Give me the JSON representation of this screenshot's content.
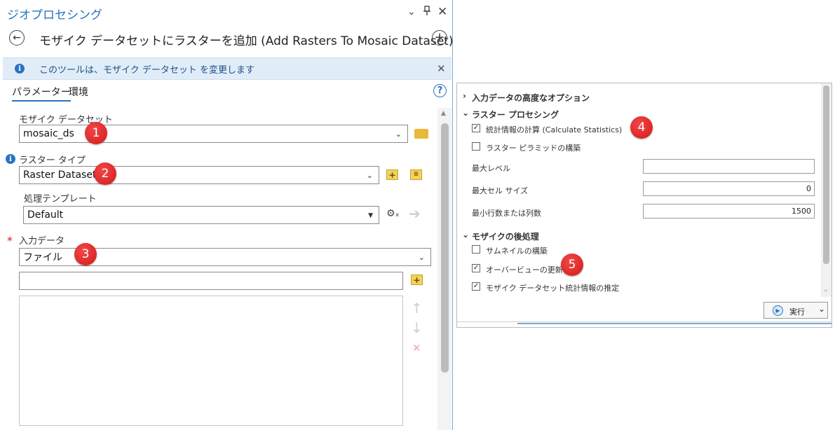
{
  "pane": {
    "title": "ジオプロセシング",
    "icons": {
      "menu": "chevron-down-icon",
      "pin": "pin-icon",
      "close": "close-icon"
    }
  },
  "tool": {
    "title": "モザイク データセットにラスターを追加 (Add Rasters To Mosaic Dataset)",
    "back_icon": "back-arrow-icon",
    "add_icon": "plus-circle-icon"
  },
  "info_banner": {
    "text": "このツールは、モザイク データセット を変更します"
  },
  "tabs": [
    {
      "label": "パラメーター"
    },
    {
      "label": "環境"
    }
  ],
  "params": {
    "mosaic_dataset": {
      "label": "モザイク データセット",
      "value": "mosaic_ds"
    },
    "raster_type": {
      "label": "ラスター タイプ",
      "value": "Raster Dataset"
    },
    "processing_template": {
      "label": "処理テンプレート",
      "value": "Default"
    },
    "input_data": {
      "label": "入力データ",
      "required_mark": "*",
      "value": "ファイル"
    }
  },
  "markers": [
    "1",
    "2",
    "3",
    "4",
    "5"
  ],
  "right_panel": {
    "sections": {
      "advanced_input": "入力データの高度なオプション",
      "raster_processing": "ラスター プロセシング",
      "mosaic_post": "モザイクの後処理"
    },
    "checkboxes": {
      "calculate_statistics": {
        "label": "統計情報の計算 (Calculate Statistics)",
        "checked": true,
        "mark": "✓"
      },
      "build_pyramids": {
        "label": "ラスター ピラミッドの構築",
        "checked": false,
        "mark": ""
      },
      "build_thumbnails": {
        "label": "サムネイルの構築",
        "checked": false,
        "mark": ""
      },
      "update_overviews": {
        "label": "オーバービューの更新",
        "checked": true,
        "mark": "✓"
      },
      "estimate_statistics": {
        "label": "モザイク データセット統計情報の推定",
        "checked": true,
        "mark": "✓"
      }
    },
    "fields": {
      "max_level": {
        "label": "最大レベル",
        "value": ""
      },
      "max_cell_size": {
        "label": "最大セル サイズ",
        "value": "0"
      },
      "min_rows_cols": {
        "label": "最小行数または列数",
        "value": "1500"
      }
    },
    "run_button": {
      "label": "実行"
    }
  },
  "colors": {
    "accent": "#2b73c0",
    "marker": "#d41919",
    "info_bg": "#e0edf8"
  }
}
